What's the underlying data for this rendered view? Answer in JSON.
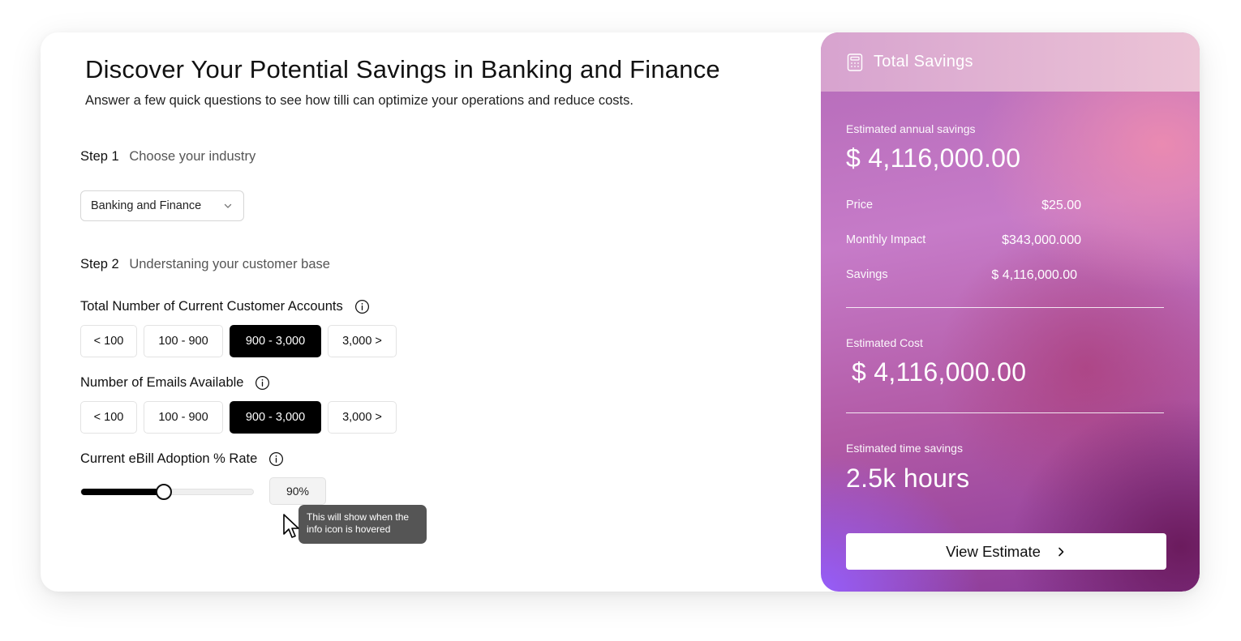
{
  "header": {
    "title": "Discover Your Potential Savings in Banking and Finance",
    "subtitle": "Answer a few quick questions to see how tilli can optimize your operations and reduce costs."
  },
  "step1": {
    "number": "Step 1",
    "description": "Choose your industry",
    "selected_industry": "Banking and Finance"
  },
  "step2": {
    "number": "Step 2",
    "description": "Understaning your customer base"
  },
  "questions": {
    "accounts": {
      "label": "Total Number of Current Customer Accounts",
      "options": [
        "< 100",
        "100 - 900",
        "900 - 3,000",
        "3,000 >"
      ],
      "selected_index": 2
    },
    "emails": {
      "label": "Number of Emails Available",
      "options": [
        "< 100",
        "100 - 900",
        "900 - 3,000",
        "3,000 >"
      ],
      "selected_index": 2
    },
    "ebill": {
      "label": "Current eBill Adoption % Rate",
      "value_text": "90%",
      "slider_fraction": 0.48,
      "tooltip": "This will show when the info icon is hovered"
    }
  },
  "summary": {
    "title": "Total Savings",
    "annual_label": "Estimated annual savings",
    "annual_value": "$ 4,116,000.00",
    "rows": [
      {
        "key": "Price",
        "value": "$25.00"
      },
      {
        "key": "Monthly Impact",
        "value": "$343,000.000"
      },
      {
        "key": "Savings",
        "value": "$ 4,116,000.00"
      }
    ],
    "cost_label": "Estimated Cost",
    "cost_value": "$ 4,116,000.00",
    "time_label": "Estimated time savings",
    "time_value": "2.5k hours",
    "button_label": "View Estimate"
  },
  "icons": {
    "info": "info-icon",
    "chevron": "chevron-down-icon",
    "calculator": "calculator-icon",
    "arrow": "chevron-right-icon",
    "cursor": "mouse-pointer-icon"
  },
  "colors": {
    "selected_option": "#000000",
    "tooltip_bg": "#555555",
    "panel_pink": "#ecc4d6",
    "panel_purple": "#9660ff"
  }
}
